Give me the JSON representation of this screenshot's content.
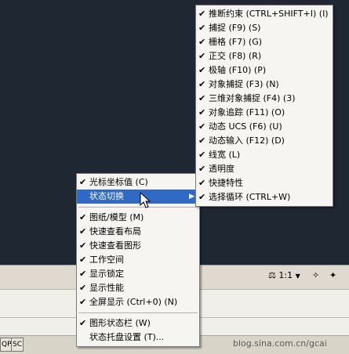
{
  "status_bar": {
    "annotation_scale": "1:1",
    "annotation_arrow": "▼",
    "left_buttons": [
      "QP",
      "SC"
    ]
  },
  "context_menu": {
    "items": [
      {
        "label": "光标坐标值 (C)",
        "checked": true
      },
      {
        "label": "状态切换",
        "submenu": true,
        "highlighted": true
      },
      {
        "separator": true
      },
      {
        "label": "图纸/模型 (M)",
        "checked": true
      },
      {
        "label": "快速查看布局",
        "checked": true
      },
      {
        "label": "快速查看图形",
        "checked": true
      },
      {
        "label": "工作空间",
        "checked": true
      },
      {
        "label": "显示锁定",
        "checked": true
      },
      {
        "label": "显示性能",
        "checked": true
      },
      {
        "label": "全屏显示 (Ctrl+0) (N)",
        "checked": true
      },
      {
        "separator": true
      },
      {
        "label": "图形状态栏 (W)",
        "checked": true
      },
      {
        "label": "状态托盘设置 (T)...",
        "checked": false
      }
    ]
  },
  "submenu": {
    "items": [
      {
        "label": "推断约束 (CTRL+SHIFT+I) (I)",
        "checked": true
      },
      {
        "label": "捕捉 (F9) (S)",
        "checked": true
      },
      {
        "label": "栅格 (F7) (G)",
        "checked": true
      },
      {
        "label": "正交 (F8) (R)",
        "checked": true
      },
      {
        "label": "极轴 (F10) (P)",
        "checked": true
      },
      {
        "label": "对象捕捉 (F3) (N)",
        "checked": true
      },
      {
        "label": "三维对象捕捉 (F4) (3)",
        "checked": true
      },
      {
        "label": "对象追踪 (F11) (O)",
        "checked": true
      },
      {
        "label": "动态 UCS (F6) (U)",
        "checked": true
      },
      {
        "label": "动态输入 (F12) (D)",
        "checked": true
      },
      {
        "label": "线宽 (L)",
        "checked": true
      },
      {
        "label": "透明度",
        "checked": true
      },
      {
        "label": "快捷特性",
        "checked": true
      },
      {
        "label": "选择循环 (CTRL+W)",
        "checked": true
      }
    ]
  },
  "watermark": "blog.sina.com.cn/gcai"
}
